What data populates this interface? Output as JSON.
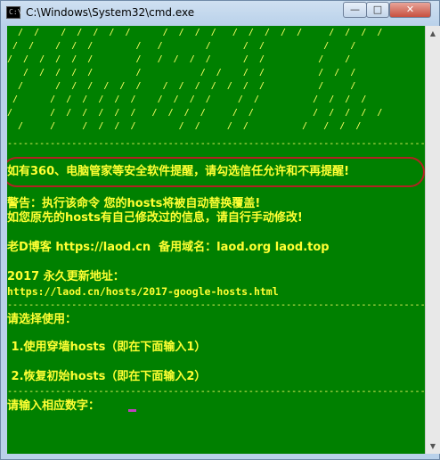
{
  "window": {
    "title": "C:\\Windows\\System32\\cmd.exe",
    "icon_text": "C:\\",
    "minimize_glyph": "—",
    "maximize_glyph": "□",
    "close_glyph": "✕"
  },
  "console": {
    "background": "#008000",
    "text_color": "#ffff33",
    "ascii_art": [
      "  /  /    /  /  /  /  /      /  /  /  /   /  /  /  /  /     /  /  /  /",
      " /  /    /  /  /        /   /        /      /  /           /    /",
      "/  /  /  /  /  /        /   /  /  /  /      /  /          /    /",
      "   /  /  /  /  /        /           /  /    /  /          /  /  /",
      "  /      /  /  /  /  /  /    /  /  /  /  /  /  /          /     /",
      " /      /  /  /  /  /  /    /  /  /  /     /  /          /  /  /  /",
      "/       /  /  /  /  /  /   /  /  /  /     /  /           /  /  /  /  /",
      "  /     /     /  /  /  /        /  /     /  /          /   /  /  /"
    ],
    "separator": "----------------------------------------------------------------------------------------",
    "warning_line": "如有360、电脑管家等安全软件提醒，请勾选信任允许和不再提醒!",
    "notice_line1": "警告：执行该命令 您的hosts将被自动替换覆盖!",
    "notice_line2": "如您原先的hosts有自己修改过的信息，请自行手动修改!",
    "blog_line": "老D博客 https://laod.cn  备用域名：laod.org laod.top",
    "update_label": "2017 永久更新地址：",
    "update_url": "https://laod.cn/hosts/2017-google-hosts.html",
    "choose_prompt": "请选择使用：",
    "option1": " 1.使用穿墙hosts（即在下面输入1）",
    "option2": " 2.恢复初始hosts（即在下面输入2）",
    "input_prompt": "请输入相应数字：",
    "cursor_color": "#c040c0"
  },
  "scrollbar": {
    "up_glyph": "▲",
    "down_glyph": "▼"
  }
}
